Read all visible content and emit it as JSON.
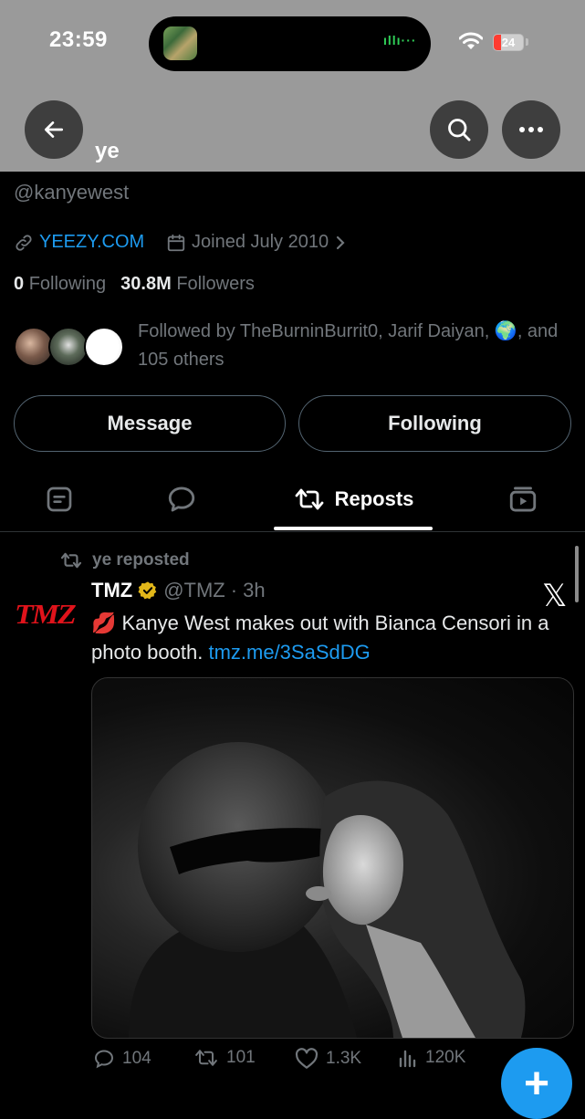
{
  "status_bar": {
    "time": "23:59",
    "battery": "24",
    "battery_level": 0.24,
    "audio_indicator": "ıllı···"
  },
  "header": {
    "title": "ye",
    "icons": [
      "back-arrow-icon",
      "search-icon",
      "more-icon"
    ]
  },
  "profile": {
    "handle": "@kanyewest",
    "website": "YEEZY.COM",
    "joined": "Joined July 2010",
    "following_count": "0",
    "following_label": "Following",
    "followers_count": "30.8M",
    "followers_label": "Followers",
    "followed_by": "Followed by TheBurninBurrit0, Jarif Daiyan, 🌍, and 105 others"
  },
  "buttons": {
    "message": "Message",
    "following": "Following"
  },
  "tabs": {
    "active_label": "Reposts",
    "icons": [
      "posts-icon",
      "replies-icon",
      "repost-icon",
      "media-icon"
    ]
  },
  "post": {
    "reposted_by": "ye reposted",
    "author_name": "TMZ",
    "author_handle": "@TMZ",
    "separator": "·",
    "time": "3h",
    "logo_text": "TMZ",
    "emoji": "💋",
    "text": " Kanye West makes out with Bianca Censori in a photo booth. ",
    "link": "tmz.me/3SaSdDG",
    "replies": "104",
    "reposts": "101",
    "likes": "1.3K",
    "views": "120K"
  },
  "fab": {
    "label": "+"
  },
  "colors": {
    "accent": "#1d9bf0",
    "verified": "#e2b719",
    "brand_tmz": "#e0131b",
    "header_bg": "#9a9a9a"
  }
}
